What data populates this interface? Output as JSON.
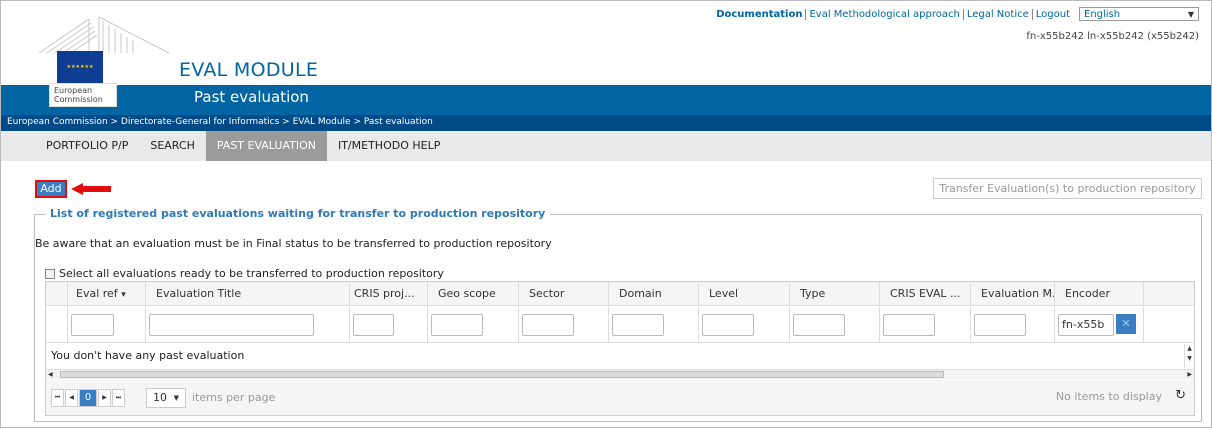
{
  "header": {
    "app_title": "EVAL MODULE",
    "subtitle": "Past evaluation",
    "logo_text": "European Commission",
    "links": [
      "Documentation",
      "Eval Methodological approach",
      "Legal Notice",
      "Logout"
    ],
    "language": "English",
    "user": "fn-x55b242 ln-x55b242 (x55b242)"
  },
  "breadcrumb": "European Commission > Directorate-General for Informatics > EVAL Module > Past evaluation",
  "nav": {
    "tabs": [
      "PORTFOLIO P/P",
      "SEARCH",
      "PAST EVALUATION",
      "IT/METHODO HELP"
    ],
    "active": "PAST EVALUATION"
  },
  "toolbar": {
    "add_label": "Add",
    "transfer_label": "Transfer Evaluation(s) to production repository"
  },
  "panel": {
    "legend": "List of registered past evaluations waiting for transfer to production repository",
    "notice": "Be aware that an evaluation must be in Final status to be transferred to production repository",
    "select_all": "Select all evaluations ready to be transferred to production repository"
  },
  "grid": {
    "columns": [
      "Eval ref",
      "Evaluation Title",
      "CRIS proj...",
      "Geo scope",
      "Sector",
      "Domain",
      "Level",
      "Type",
      "CRIS EVAL ...",
      "Evaluation M...",
      "Encoder"
    ],
    "sort_indicator": "▾",
    "encoder_filter_value": "fn-x55b",
    "empty_message": "You don't have any past evaluation",
    "current_page": "0",
    "page_size": "10",
    "items_per_page": "items per page",
    "no_items": "No items to display"
  },
  "colors": {
    "brand_blue": "#0065a2",
    "button_blue": "#3a7fc3",
    "highlight_red": "#e20d0d"
  }
}
